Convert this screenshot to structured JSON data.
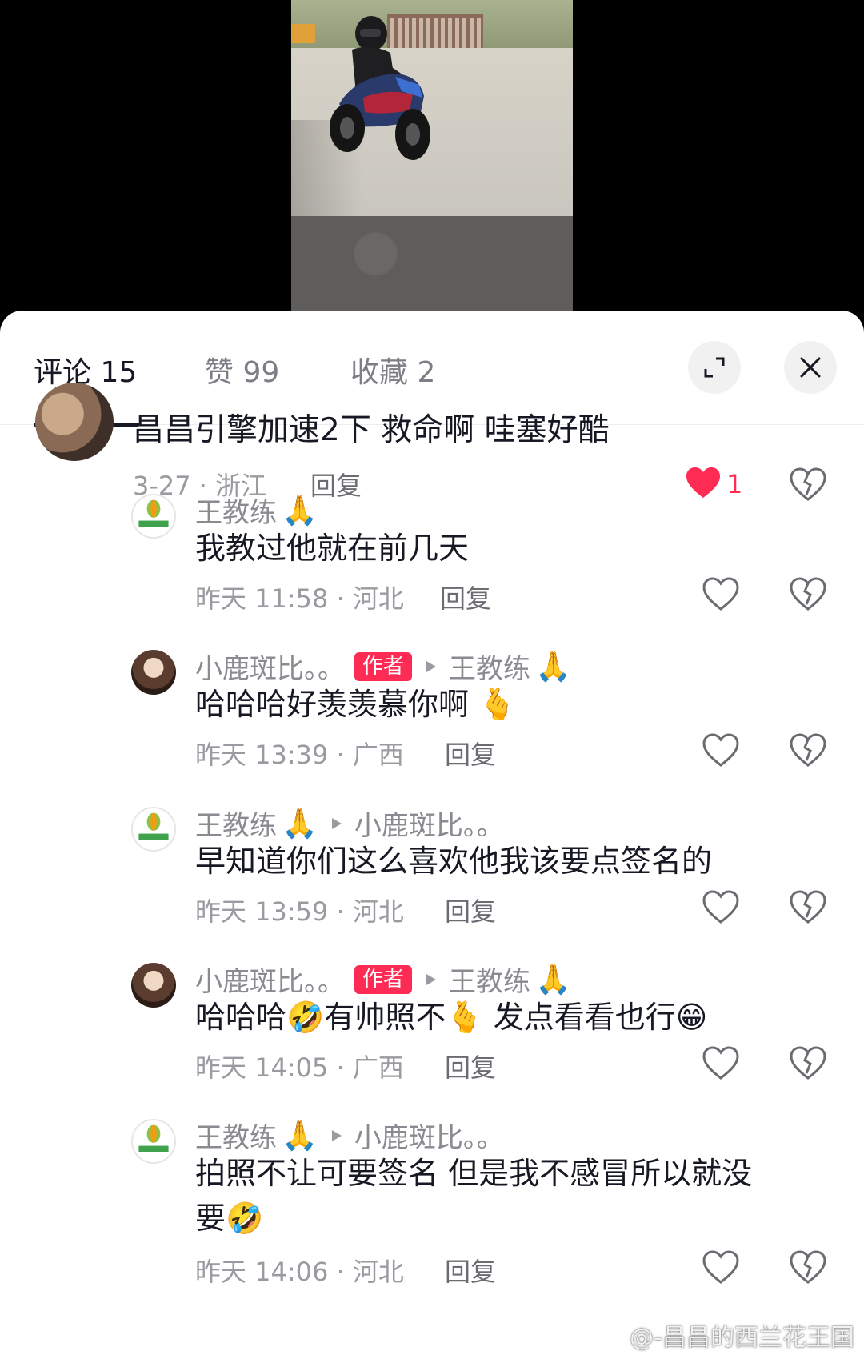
{
  "tabs": [
    {
      "label": "评论 15"
    },
    {
      "label": "赞 99"
    },
    {
      "label": "收藏 2"
    }
  ],
  "header_icons": {
    "expand": "expand-icon",
    "close": "close-icon"
  },
  "colors": {
    "accent": "#fe2c55",
    "text": "#161823",
    "muted": "#8a8b91"
  },
  "top_comment": {
    "text": "昌昌引擎加速2下 救命啊 哇塞好酷",
    "meta": "3-27 · 浙江",
    "reply": "回复",
    "likes": "1"
  },
  "replies": [
    {
      "name": "王教练",
      "emoji": "🙏",
      "author": "",
      "to": "",
      "to_emoji": "",
      "text": "我教过他就在前几天",
      "meta": "昨天 11:58 · 河北",
      "reply": "回复"
    },
    {
      "name": "小鹿斑比。。",
      "emoji": "",
      "author": "作者",
      "to": "王教练",
      "to_emoji": "🙏",
      "text": "哈哈哈好羡羡慕你啊 🫰",
      "meta": "昨天 13:39 · 广西",
      "reply": "回复"
    },
    {
      "name": "王教练",
      "emoji": "🙏",
      "author": "",
      "to": "小鹿斑比。。",
      "to_emoji": "",
      "text": "早知道你们这么喜欢他我该要点签名的",
      "meta": "昨天 13:59 · 河北",
      "reply": "回复"
    },
    {
      "name": "小鹿斑比。。",
      "emoji": "",
      "author": "作者",
      "to": "王教练",
      "to_emoji": "🙏",
      "text": "哈哈哈🤣有帅照不🫰 发点看看也行😁",
      "meta": "昨天 14:05 · 广西",
      "reply": "回复"
    },
    {
      "name": "王教练",
      "emoji": "🙏",
      "author": "",
      "to": "小鹿斑比。。",
      "to_emoji": "",
      "text": "拍照不让可要签名  但是我不感冒所以就没",
      "text2": "要🤣",
      "meta": "昨天 14:06 · 河北",
      "reply": "回复"
    }
  ],
  "watermark": "@-昌昌的西兰花王国"
}
